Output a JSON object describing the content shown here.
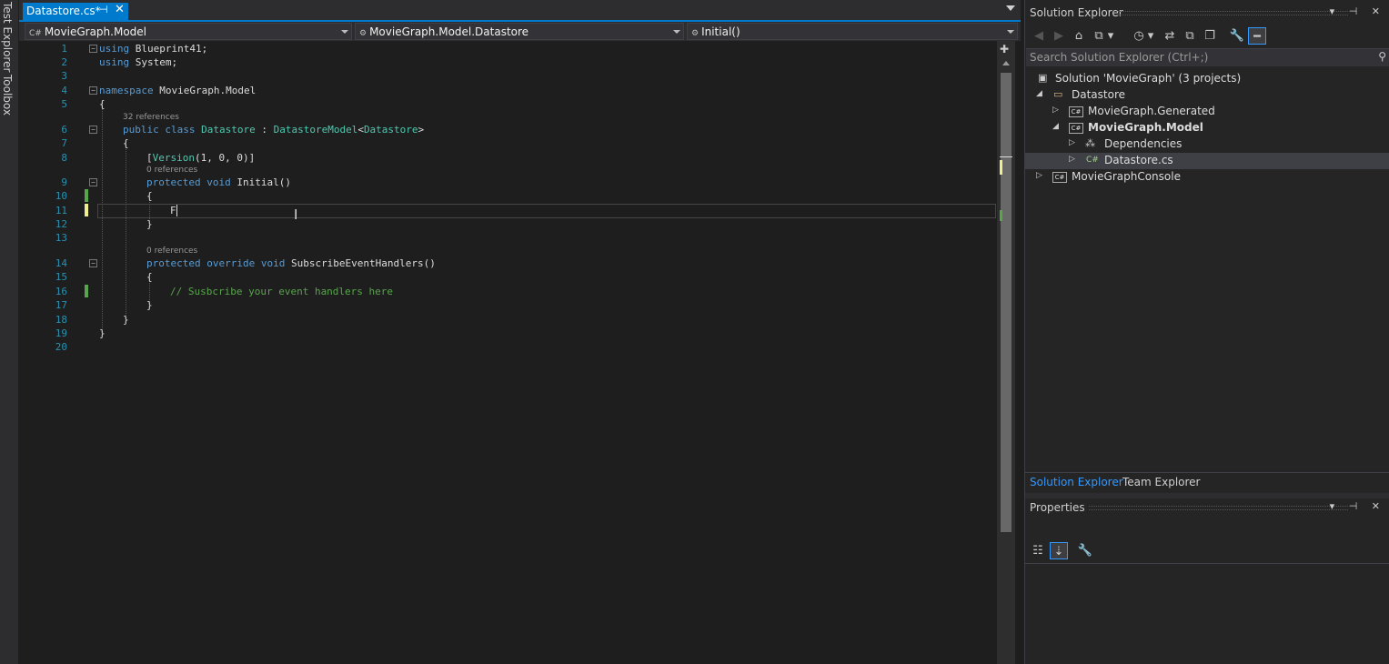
{
  "left_rail": {
    "tabs": [
      "Test Explorer",
      "Toolbox"
    ]
  },
  "editor": {
    "tab": {
      "title": "Datastore.cs*",
      "pin_glyph": "⊣",
      "close_glyph": "✕"
    },
    "nav": {
      "project": "MovieGraph.Model",
      "type": "MovieGraph.Model.Datastore",
      "member": "Initial()"
    },
    "line_numbers": [
      "1",
      "2",
      "3",
      "4",
      "5",
      "6",
      "7",
      "8",
      "9",
      "10",
      "11",
      "12",
      "13",
      "14",
      "15",
      "16",
      "17",
      "18",
      "19",
      "20"
    ],
    "code": {
      "l1_kw": "using",
      "l1_rest": " Blueprint41;",
      "l2_kw": "using",
      "l2_rest": " System;",
      "l4_kw": "namespace",
      "l4_rest": " MovieGraph.Model",
      "l5": "{",
      "lens_class": "32 references",
      "l6_kw": "public class",
      "l6_type": "Datastore",
      "l6_sep": " : ",
      "l6_base": "DatastoreModel",
      "l6_lt": "<",
      "l6_arg": "Datastore",
      "l6_gt": ">",
      "l7": "{",
      "l8_open": "[",
      "l8_attr": "Version",
      "l8_args": "(1, 0, 0)]",
      "lens_initial": "0 references",
      "l9_kw": "protected void",
      "l9_rest": " Initial()",
      "l10": "{",
      "l11": "F",
      "l12": "}",
      "lens_subscribe": "0 references",
      "l14_kw": "protected override void",
      "l14_rest": " SubscribeEventHandlers()",
      "l15": "{",
      "l16_comment": "// Susbcribe your event handlers here",
      "l17": "}",
      "l18": "}",
      "l19": "}"
    }
  },
  "solution_explorer": {
    "title": "Solution Explorer",
    "search_placeholder": "Search Solution Explorer (Ctrl+;)",
    "tree": [
      {
        "label": "Solution 'MovieGraph' (3 projects)"
      },
      {
        "label": "Datastore"
      },
      {
        "label": "MovieGraph.Generated"
      },
      {
        "label": "MovieGraph.Model"
      },
      {
        "label": "Dependencies"
      },
      {
        "label": "Datastore.cs"
      },
      {
        "label": "MovieGraphConsole"
      }
    ],
    "bottom_tabs": [
      "Solution Explorer",
      "Team Explorer"
    ]
  },
  "properties": {
    "title": "Properties"
  },
  "colors": {
    "accent": "#007acc",
    "keyword": "#569cd6",
    "type": "#4ec9b0",
    "comment": "#57a64a",
    "line_number": "#2b91af",
    "saved_change": "#57a64a",
    "unsaved_change": "#efef8f"
  },
  "icons": [
    "pin-icon",
    "close-icon",
    "home-icon",
    "sync-icon",
    "wrench-icon",
    "search-icon",
    "folder-icon",
    "csharp-project-icon",
    "csharp-file-icon",
    "dependencies-icon",
    "solution-icon"
  ]
}
